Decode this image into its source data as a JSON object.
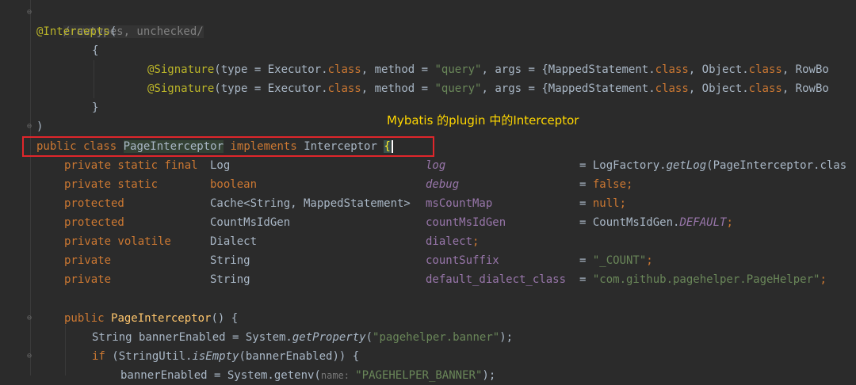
{
  "lines": {
    "l1": {
      "text": "/rawtypes, unchecked/"
    },
    "l2": {
      "ann": "@Intercepts",
      "paren": "("
    },
    "l3": {
      "brace": "{"
    },
    "l4": {
      "ann": "@Signature",
      "p1": "(type = Executor.",
      "kw": "class",
      "p2": ", method = ",
      "str": "\"query\"",
      "p3": ", args = {MappedStatement.",
      "kw2": "class",
      "p4": ", Object.",
      "kw3": "class",
      "p5": ", RowBo"
    },
    "l5": {
      "ann": "@Signature",
      "p1": "(type = Executor.",
      "kw": "class",
      "p2": ", method = ",
      "str": "\"query\"",
      "p3": ", args = {MappedStatement.",
      "kw2": "class",
      "p4": ", Object.",
      "kw3": "class",
      "p5": ", RowBo"
    },
    "l6": {
      "brace": "}"
    },
    "l7": {
      "paren": ")"
    },
    "l8": {
      "kw1": "public class",
      "cls": "PageInterceptor",
      "kw2": "implements",
      "iface": "Interceptor",
      "brace": "{"
    },
    "fields": [
      {
        "mod": "private static final",
        "type": "Log",
        "name": "log",
        "eq": "= LogFactory.",
        "call": "getLog",
        "rest": "(PageInterceptor.clas"
      },
      {
        "mod": "private static",
        "type": "boolean",
        "name": "debug",
        "eq": "= ",
        "val": "false",
        "semi": ";"
      },
      {
        "mod": "protected",
        "type": "Cache<String, MappedStatement>",
        "name": "msCountMap",
        "eq": "= ",
        "val": "null",
        "semi": ";"
      },
      {
        "mod": "protected",
        "type": "CountMsIdGen",
        "name": "countMsIdGen",
        "eq": "= CountMsIdGen.",
        "val": "DEFAULT",
        "semi": ";"
      },
      {
        "mod": "private volatile",
        "type": "Dialect",
        "name": "dialect",
        "semi": ";"
      },
      {
        "mod": "private",
        "type": "String",
        "name": "countSuffix",
        "eq": "= ",
        "val": "\"_COUNT\"",
        "semi": ";"
      },
      {
        "mod": "private",
        "type": "String",
        "name": "default_dialect_class",
        "eq": "= ",
        "val": "\"com.github.pagehelper.PageHelper\"",
        "semi": ";"
      }
    ],
    "ctor": {
      "kw": "public",
      "name": "PageInterceptor",
      "rest": "() {"
    },
    "b1": {
      "p1": "String bannerEnabled = System.",
      "call": "getProperty",
      "p2": "(",
      "str": "\"pagehelper.banner\"",
      "p3": ");"
    },
    "b2": {
      "kw": "if",
      "p1": " (StringUtil.",
      "call": "isEmpty",
      "p2": "(bannerEnabled)) {"
    },
    "b3": {
      "p1": "bannerEnabled = System.getenv(",
      "hint": "name: ",
      "str": "\"PAGEHELPER_BANNER\"",
      "p2": ");"
    }
  },
  "overlay_text": "Mybatis 的plugin 中的Interceptor"
}
